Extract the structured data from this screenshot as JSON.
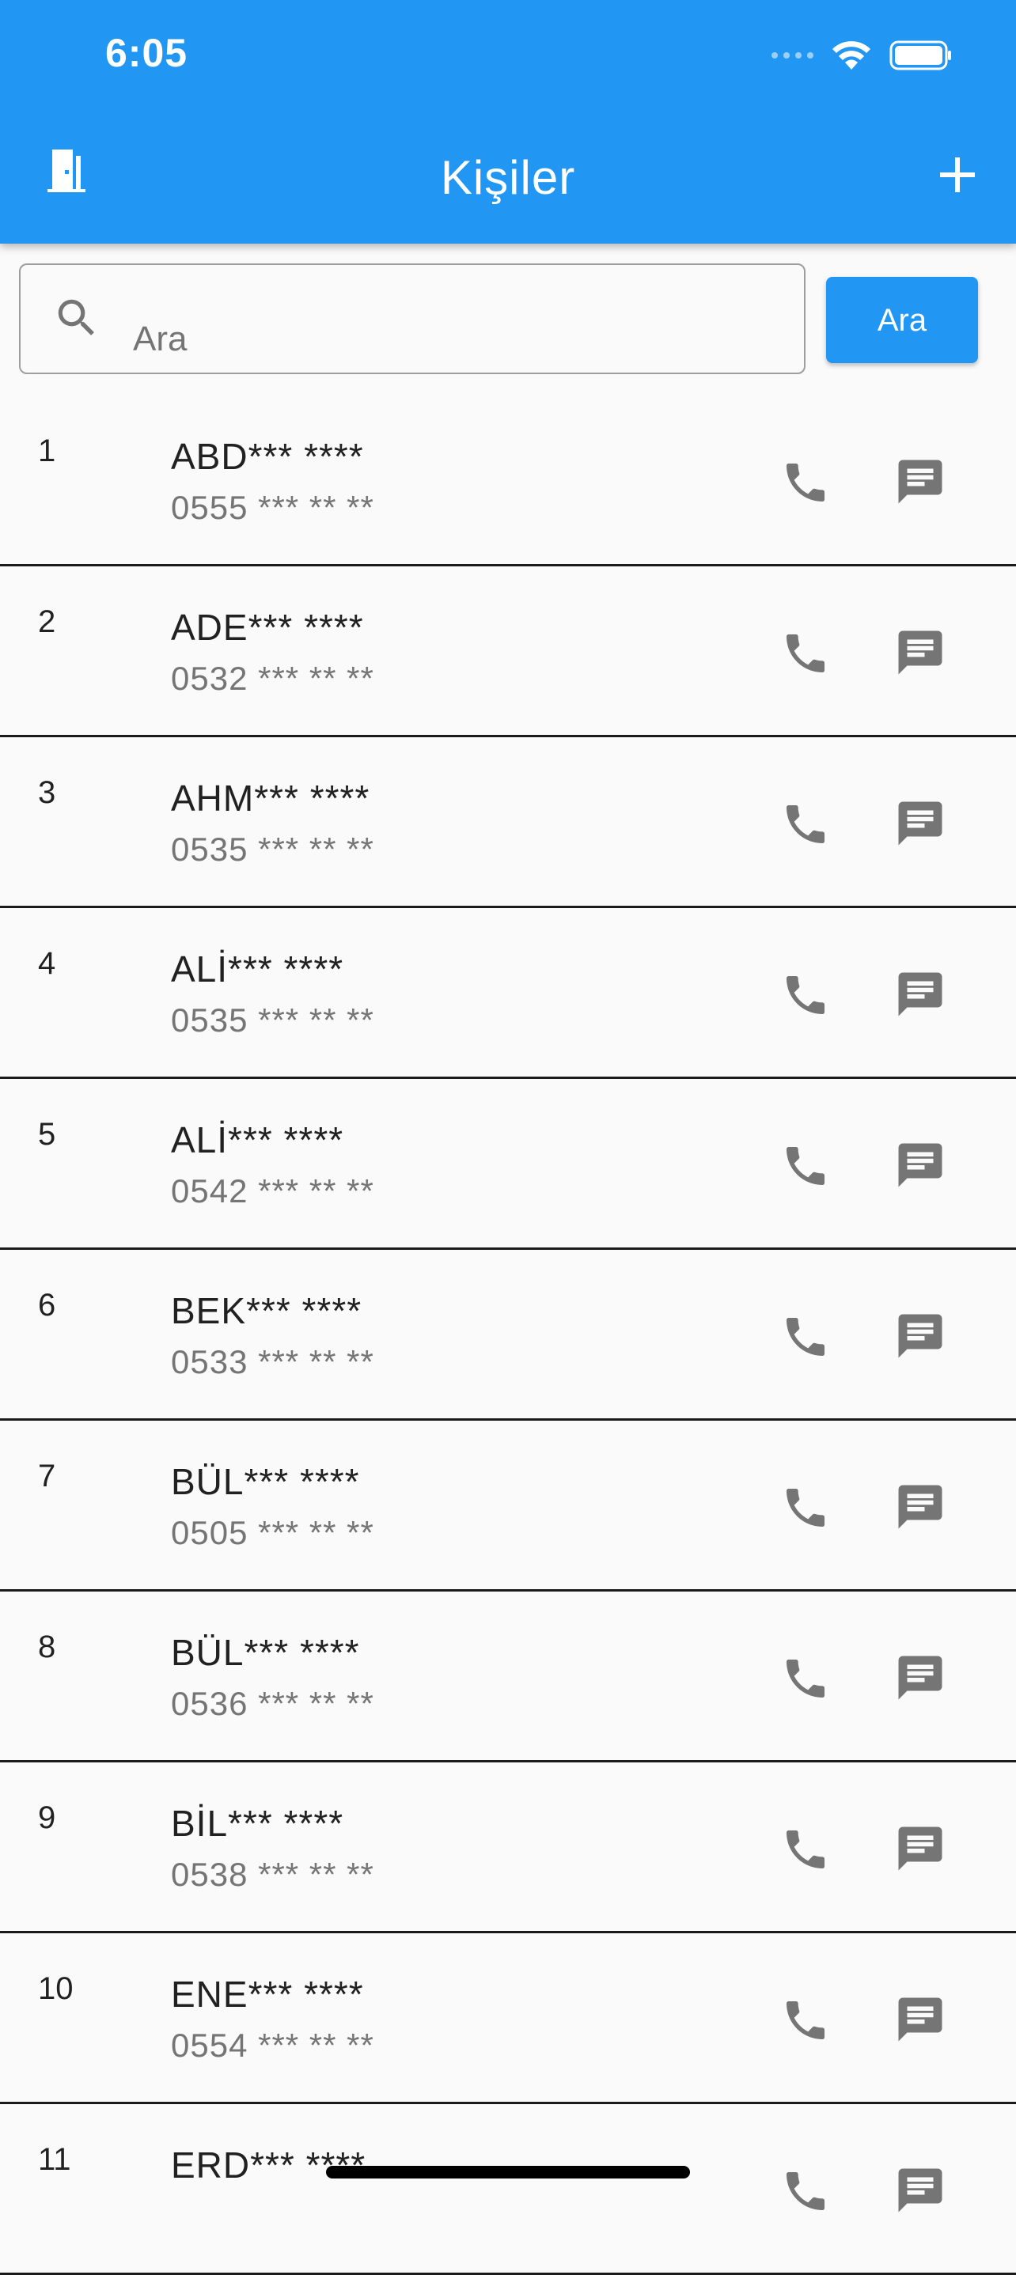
{
  "status_bar": {
    "time": "6:05"
  },
  "app_bar": {
    "title": "Kişiler",
    "exit_icon": "door-exit-icon",
    "add_icon": "plus-icon"
  },
  "search": {
    "value": "",
    "placeholder": "Ara",
    "button_label": "Ara"
  },
  "contacts": [
    {
      "num": "1",
      "name": "ABD*** ****",
      "phone": "0555 *** ** **"
    },
    {
      "num": "2",
      "name": "ADE*** ****",
      "phone": "0532 *** ** **"
    },
    {
      "num": "3",
      "name": "AHM*** ****",
      "phone": "0535 *** ** **"
    },
    {
      "num": "4",
      "name": "ALİ*** ****",
      "phone": "0535 *** ** **"
    },
    {
      "num": "5",
      "name": "ALİ*** ****",
      "phone": "0542 *** ** **"
    },
    {
      "num": "6",
      "name": "BEK*** ****",
      "phone": "0533 *** ** **"
    },
    {
      "num": "7",
      "name": "BÜL*** ****",
      "phone": "0505 *** ** **"
    },
    {
      "num": "8",
      "name": "BÜL*** ****",
      "phone": "0536 *** ** **"
    },
    {
      "num": "9",
      "name": "BİL*** ****",
      "phone": "0538 *** ** **"
    },
    {
      "num": "10",
      "name": "ENE*** ****",
      "phone": "0554 *** ** **"
    },
    {
      "num": "11",
      "name": "ERD*** ****",
      "phone": ""
    }
  ],
  "colors": {
    "primary": "#2196f3",
    "icon_gray": "#757575",
    "divider": "#1a1a1a"
  }
}
